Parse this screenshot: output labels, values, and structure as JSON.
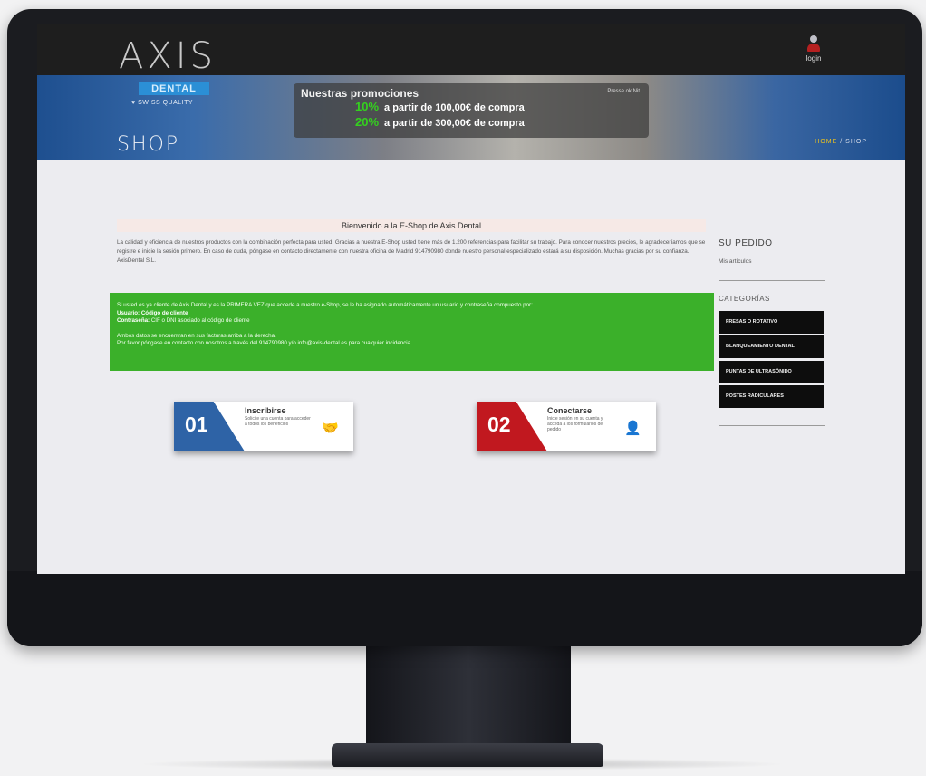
{
  "header": {
    "logo_text": "AXIS",
    "login_label": "login"
  },
  "banner": {
    "brand_box": "DENTAL",
    "brand_sub": "♥ SWISS QUALITY",
    "page_title": "SHOP",
    "promo": {
      "title": "Nuestras promociones",
      "close_text": "Presse ok Nit",
      "lines": [
        {
          "pct": "10%",
          "text": "a partir de 100,00€ de compra"
        },
        {
          "pct": "20%",
          "text": "a partir de 300,00€ de compra"
        }
      ]
    },
    "breadcrumb": {
      "home": "HOME",
      "sep": "/",
      "current": "SHOP"
    }
  },
  "main": {
    "welcome_title": "Bienvenido a la E-Shop de Axis Dental",
    "intro_text": "La calidad y eficiencia de nuestros productos con la combinación perfecta para usted. Gracias a nuestra E-Shop usted tiene más de 1.200 referencias para facilitar su trabajo. Para conocer nuestros precios, le agradeceríamos que se registre e inicie la sesión primero. En caso de duda, póngase en contacto directamente con nuestra oficina de Madrid 914790980 donde nuestro personal especializado estará a su disposición. Muchas gracias por su confianza. AxisDental S.L.",
    "notice": {
      "line1": "Si usted es ya cliente de Axis Dental y es la PRIMERA VEZ que accede a nuestro e-Shop, se le ha asignado automáticamente un usuario y contraseña compuesto por:",
      "user_label": "Usuario:",
      "user_value": "Código de cliente",
      "pass_label": "Contraseña:",
      "pass_value": "CIF o DNI asociado al código de cliente",
      "line4": "Ambos datos se encuentran en sus facturas arriba a la derecha.",
      "line5": "Por favor póngase en contacto con nosotros a través del 914790980 y/o info@axis-dental.es para cualquier incidencia."
    },
    "steps": [
      {
        "num": "01",
        "title": "Inscribirse",
        "desc": "Solicite una cuenta para acceder a todos los beneficios",
        "icon": "🤝"
      },
      {
        "num": "02",
        "title": "Conectarse",
        "desc": "Inicie sesión en su cuenta y acceda a los formularios de pedido",
        "icon": "👤"
      }
    ]
  },
  "sidebar": {
    "order_title": "SU PEDIDO",
    "order_sub": "Mis artículos",
    "categories_title": "CATEGORÍAS",
    "categories": [
      "FRESAS O ROTATIVO",
      "BLANQUEAMIENTO DENTAL",
      "PUNTAS DE ULTRASÓNIDO",
      "POSTES RADICULARES"
    ]
  }
}
